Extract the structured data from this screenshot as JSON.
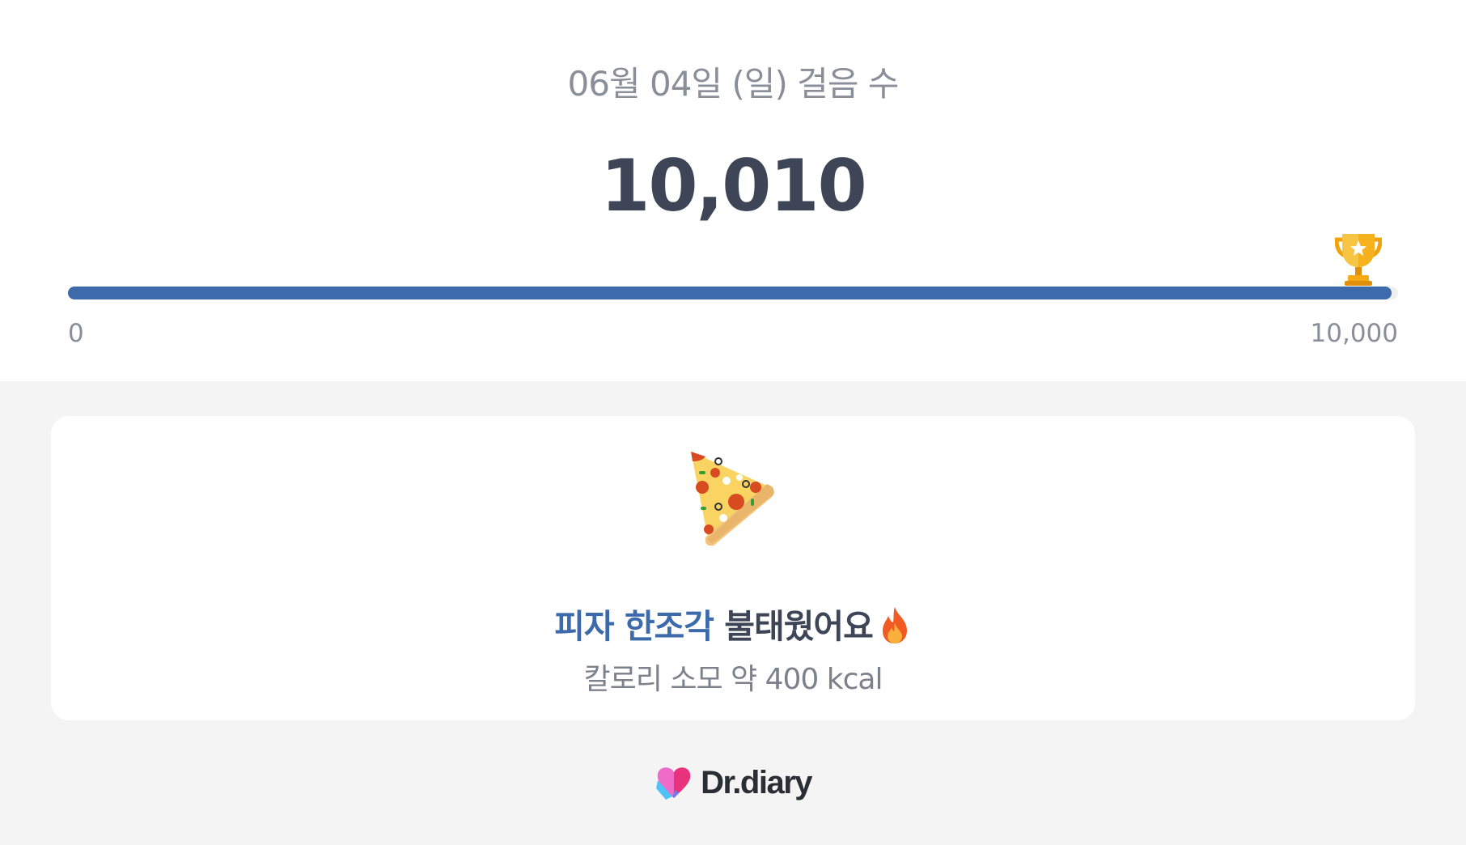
{
  "header": {
    "date_title": "06월 04일 (일) 걸음 수",
    "step_count": "10,010"
  },
  "progress": {
    "fraction": 0.995,
    "min_label": "0",
    "max_label": "10,000",
    "fill_color": "#3d6aab",
    "track_color": "#efefef",
    "goal_icon": "trophy-icon"
  },
  "summary_card": {
    "food_icon": "pizza-slice-icon",
    "food_text": "피자 한조각",
    "burned_text": " 불태웠어요",
    "fire_icon": "fire-icon",
    "calorie_text": "칼로리 소모 약 400 kcal",
    "accent_color": "#3d6aab"
  },
  "footer": {
    "brand_icon": "heart-logo-icon",
    "brand_name": "Dr.diary"
  }
}
